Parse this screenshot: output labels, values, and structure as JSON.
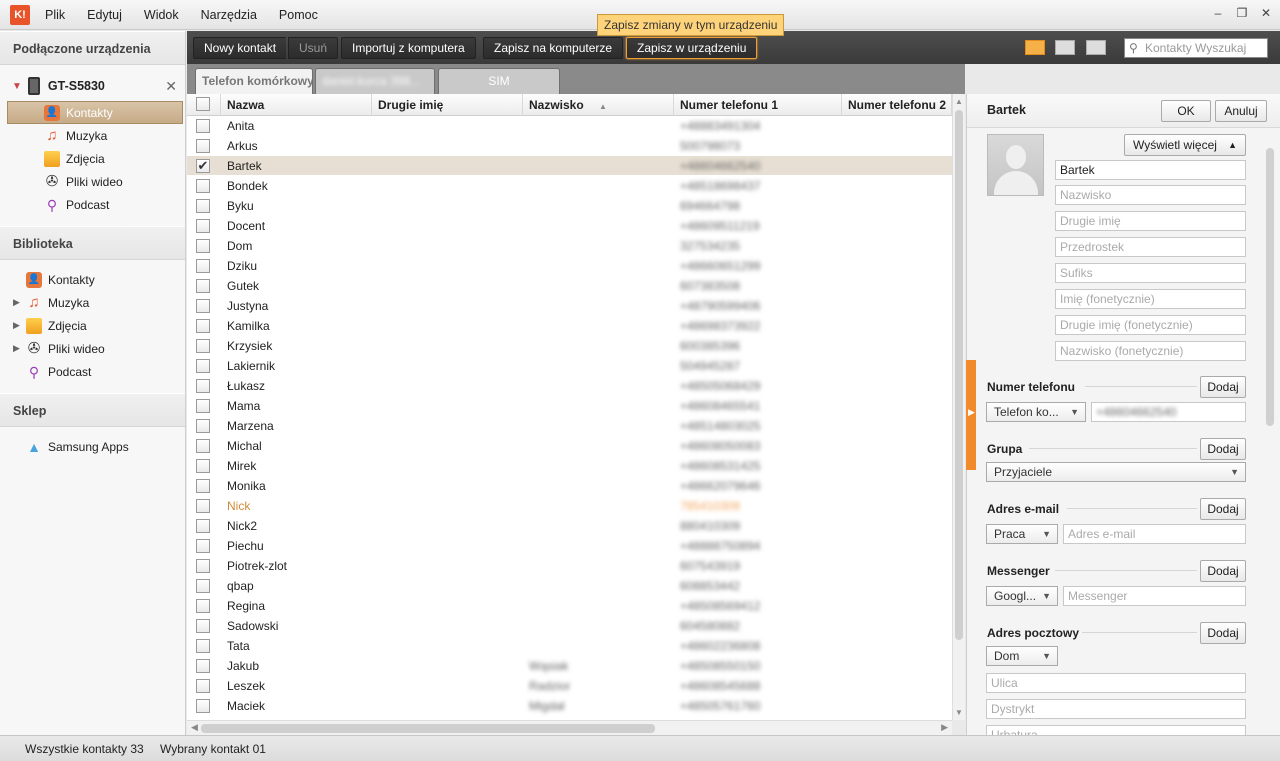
{
  "app": {
    "logo_text": "K!",
    "menu": [
      "Plik",
      "Edytuj",
      "Widok",
      "Narzędzia",
      "Pomoc"
    ],
    "window_controls": [
      "–",
      "❐",
      "✕"
    ]
  },
  "sidebar": {
    "connected_header": "Podłączone urządzenia",
    "device_name": "GT-S5830",
    "device_items": [
      {
        "label": "Kontakty",
        "icon": "contacts-icon"
      },
      {
        "label": "Muzyka",
        "icon": "music-icon"
      },
      {
        "label": "Zdjęcia",
        "icon": "photos-icon"
      },
      {
        "label": "Pliki wideo",
        "icon": "video-icon"
      },
      {
        "label": "Podcast",
        "icon": "podcast-icon"
      }
    ],
    "library_header": "Biblioteka",
    "library_items": [
      {
        "label": "Kontakty",
        "icon": "contacts-icon"
      },
      {
        "label": "Muzyka",
        "icon": "music-icon"
      },
      {
        "label": "Zdjęcia",
        "icon": "photos-icon"
      },
      {
        "label": "Pliki wideo",
        "icon": "video-icon"
      },
      {
        "label": "Podcast",
        "icon": "podcast-icon"
      }
    ],
    "shop_header": "Sklep",
    "shop_item": "Samsung Apps"
  },
  "toolbar": {
    "new_contact": "Nowy kontakt",
    "delete": "Usuń",
    "import": "Importuj z komputera",
    "save_pc": "Zapisz na komputerze",
    "save_device": "Zapisz w urządzeniu",
    "tooltip": "Zapisz zmiany w tym urządzeniu",
    "search_placeholder": "Kontakty Wyszukaj"
  },
  "tabs": {
    "phone": "Telefon komórkowy",
    "account": "daniel.kurca 398...",
    "sim": "SIM"
  },
  "table": {
    "columns": [
      "Nazwa",
      "Drugie imię",
      "Nazwisko",
      "Numer telefonu 1",
      "Numer telefonu 2"
    ],
    "sort_indicator": "▲",
    "rows": [
      {
        "name": "Anita",
        "mid": "",
        "last": "",
        "phone": "+48883491304",
        "checked": false
      },
      {
        "name": "Arkus",
        "mid": "",
        "last": "",
        "phone": "500798073",
        "checked": false
      },
      {
        "name": "Bartek",
        "mid": "",
        "last": "",
        "phone": "+48604662540",
        "checked": true
      },
      {
        "name": "Bondek",
        "mid": "",
        "last": "",
        "phone": "+48518698437",
        "checked": false
      },
      {
        "name": "Byku",
        "mid": "",
        "last": "",
        "phone": "694664798",
        "checked": false
      },
      {
        "name": "Docent",
        "mid": "",
        "last": "",
        "phone": "+48609511219",
        "checked": false
      },
      {
        "name": "Dom",
        "mid": "",
        "last": "",
        "phone": "327534235",
        "checked": false
      },
      {
        "name": "Dziku",
        "mid": "",
        "last": "",
        "phone": "+48660651299",
        "checked": false
      },
      {
        "name": "Gutek",
        "mid": "",
        "last": "",
        "phone": "607383508",
        "checked": false
      },
      {
        "name": "Justyna",
        "mid": "",
        "last": "",
        "phone": "+48790599406",
        "checked": false
      },
      {
        "name": "Kamilka",
        "mid": "",
        "last": "",
        "phone": "+48698373922",
        "checked": false
      },
      {
        "name": "Krzysiek",
        "mid": "",
        "last": "",
        "phone": "600385396",
        "checked": false
      },
      {
        "name": "Lakiernik",
        "mid": "",
        "last": "",
        "phone": "504945287",
        "checked": false
      },
      {
        "name": "Łukasz",
        "mid": "",
        "last": "",
        "phone": "+48505068429",
        "checked": false
      },
      {
        "name": "Mama",
        "mid": "",
        "last": "",
        "phone": "+48608465541",
        "checked": false
      },
      {
        "name": "Marzena",
        "mid": "",
        "last": "",
        "phone": "+48514803025",
        "checked": false
      },
      {
        "name": "Michal",
        "mid": "",
        "last": "",
        "phone": "+48608050083",
        "checked": false
      },
      {
        "name": "Mirek",
        "mid": "",
        "last": "",
        "phone": "+48608531425",
        "checked": false
      },
      {
        "name": "Monika",
        "mid": "",
        "last": "",
        "phone": "+48662079646",
        "checked": false
      },
      {
        "name": "Nick",
        "mid": "",
        "last": "",
        "phone": "785410309",
        "checked": false,
        "highlight": true
      },
      {
        "name": "Nick2",
        "mid": "",
        "last": "",
        "phone": "880410309",
        "checked": false
      },
      {
        "name": "Piechu",
        "mid": "",
        "last": "",
        "phone": "+48888750894",
        "checked": false
      },
      {
        "name": "Piotrek-zlot",
        "mid": "",
        "last": "",
        "phone": "607543919",
        "checked": false
      },
      {
        "name": "qbap",
        "mid": "",
        "last": "",
        "phone": "608853442",
        "checked": false
      },
      {
        "name": "Regina",
        "mid": "",
        "last": "",
        "phone": "+48508569412",
        "checked": false
      },
      {
        "name": "Sadowski",
        "mid": "",
        "last": "",
        "phone": "604580882",
        "checked": false
      },
      {
        "name": "Tata",
        "mid": "",
        "last": "",
        "phone": "+48602236808",
        "checked": false
      },
      {
        "name": "Jakub",
        "mid": "",
        "last": "Wąsiak",
        "phone": "+48508550150",
        "checked": false
      },
      {
        "name": "Leszek",
        "mid": "",
        "last": "Radzior",
        "phone": "+48608545688",
        "checked": false
      },
      {
        "name": "Maciek",
        "mid": "",
        "last": "Migdał",
        "phone": "+48505761760",
        "checked": false
      }
    ]
  },
  "detail": {
    "name": "Bartek",
    "ok": "OK",
    "cancel": "Anuluj",
    "show_more": "Wyświetl więcej",
    "fields": {
      "first_name": "Bartek",
      "last_name_ph": "Nazwisko",
      "middle_ph": "Drugie imię",
      "prefix_ph": "Przedrostek",
      "suffix_ph": "Sufiks",
      "first_phon_ph": "Imię (fonetycznie)",
      "middle_phon_ph": "Drugie imię (fonetycznie)",
      "last_phon_ph": "Nazwisko (fonetycznie)"
    },
    "phone_section": "Numer telefonu",
    "phone_type": "Telefon ko...",
    "phone_value": "+48604662540",
    "group_section": "Grupa",
    "group_value": "Przyjaciele",
    "email_section": "Adres e-mail",
    "email_type": "Praca",
    "email_ph": "Adres e-mail",
    "messenger_section": "Messenger",
    "messenger_type": "Googl...",
    "messenger_ph": "Messenger",
    "postal_section": "Adres pocztowy",
    "postal_type": "Dom",
    "street_ph": "Ulica",
    "district_ph": "Dystrykt",
    "city_ph": "Urbatura",
    "add": "Dodaj"
  },
  "status": {
    "all": "Wszystkie kontakty 33",
    "selected": "Wybrany kontakt 01"
  }
}
